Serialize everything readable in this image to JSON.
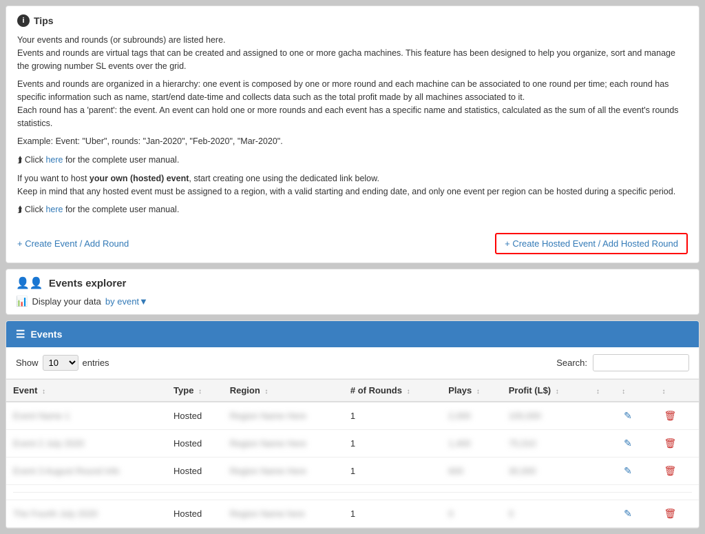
{
  "tips": {
    "header": "Tips",
    "paragraphs": [
      "Your events and rounds (or subrounds) are listed here.",
      "Events and rounds are virtual tags that can be created and assigned to one or more gacha machines. This feature has been designed to help you organize, sort and manage the growing number SL events over the grid.",
      "Events and rounds are organized in a hierarchy: one event is composed by one or more round and each machine can be associated to one round per time; each round has specific information such as name, start/end date-time and collects data such as the total profit made by all machines associated to it.",
      "Each round has a 'parent': the event. An event can hold one or more rounds and each event has a specific name and statistics, calculated as the sum of all the event's rounds statistics.",
      "Example: Event: \"Uber\", rounds: \"Jan-2020\", \"Feb-2020\", \"Mar-2020\".",
      "Click here for the complete user manual.",
      "If you want to host your own (hosted) event, start creating one using the dedicated link below.",
      "Keep in mind that any hosted event must be assigned to a region, with a valid starting and ending date, and only one event per region can be hosted during a specific period.",
      "Click here for the complete user manual."
    ],
    "here_link": "here",
    "here_link2": "here",
    "create_event_label": "+ Create Event / Add Round",
    "create_hosted_label": "+ Create Hosted Event / Add Hosted Round"
  },
  "explorer": {
    "header": "Events explorer",
    "display_label": "Display your data",
    "display_link": "by event"
  },
  "events_table": {
    "header": "Events",
    "show_label": "Show",
    "show_value": "10",
    "entries_label": "entries",
    "search_label": "Search:",
    "search_placeholder": "",
    "columns": [
      "Event",
      "Type",
      "Region",
      "# of Rounds",
      "Plays",
      "Profit (L$)",
      "",
      "",
      ""
    ],
    "rows": [
      {
        "event": "Event Name 1",
        "type": "Hosted",
        "region": "Region Name Here",
        "rounds": "1",
        "plays": "2,000",
        "profit": "100,000"
      },
      {
        "event": "Event 2 July 2020",
        "type": "Hosted",
        "region": "Region Name Here",
        "rounds": "1",
        "plays": "1,400",
        "profit": "75,010"
      },
      {
        "event": "Event 3 August\nRound Info",
        "type": "Hosted",
        "region": "Region Name Here",
        "rounds": "1",
        "plays": "600",
        "profit": "30,000"
      },
      {
        "event": "The Fourth July\n2020",
        "type": "Hosted",
        "region": "Region Name here",
        "rounds": "1",
        "plays": "0",
        "profit": "0"
      }
    ]
  }
}
